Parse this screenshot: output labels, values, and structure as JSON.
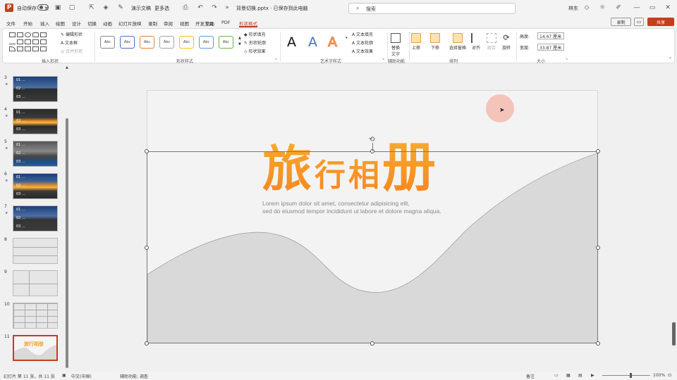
{
  "titlebar": {
    "autosave": "自动保存",
    "autosave_state": "关",
    "present_label": "演示文稿",
    "more_label": "更多选",
    "filename": "背景切换.pptx · 已保存到此电脑",
    "search_placeholder": "搜索",
    "user": "林东",
    "save_icon": "save-icon",
    "brand_color": "#c43e1c"
  },
  "menu": {
    "tabs": [
      "文件",
      "开始",
      "插入",
      "绘图",
      "设计",
      "切换",
      "动画",
      "幻灯片放映",
      "录制",
      "审阅",
      "视图",
      "开发工具",
      "帮助",
      "PDF",
      "形状格式"
    ],
    "active_tab": "形状格式",
    "share_label": "共享",
    "record_label": "录制"
  },
  "ribbon": {
    "groups": {
      "insert_shapes": "插入形状",
      "shape_styles": "形状样式",
      "art_styles": "艺术字样式",
      "accessibility": "辅助功能",
      "arrange": "排列",
      "size": "大小"
    },
    "insert_shapes": {
      "edit_shape": "编辑形状",
      "textbox": "文本框",
      "merge": "合并形状"
    },
    "shape_styles": {
      "fill": "形状填充",
      "outline": "形状轮廓",
      "effects": "形状效果",
      "preset_label": "Abc"
    },
    "art_styles": {
      "letter": "A",
      "fill": "文本填充",
      "outline": "文本轮廓",
      "effects": "文本效果"
    },
    "accessibility": {
      "alt_text_1": "替换",
      "alt_text_2": "文字"
    },
    "arrange": {
      "forward": "上移",
      "backward": "下移",
      "selection_pane": "选择窗格",
      "align": "对齐",
      "group": "组合",
      "rotate": "旋转"
    },
    "size": {
      "height_label": "高度:",
      "height_value": "14.47 厘米",
      "width_label": "宽度:",
      "width_value": "33.87 厘米"
    }
  },
  "thumbnails": [
    {
      "num": "3",
      "star": "★",
      "lines": [
        "01 ...",
        "02 ...",
        "03 ..."
      ],
      "theme": "blue"
    },
    {
      "num": "4",
      "star": "★",
      "lines": [
        "01 ...",
        "02 ...",
        "03 ..."
      ],
      "theme": "sunset"
    },
    {
      "num": "5",
      "star": "★",
      "lines": [
        "01 ...",
        "02 ...",
        "03 ..."
      ],
      "theme": "grey"
    },
    {
      "num": "6",
      "star": "★",
      "lines": [
        "01 ...",
        "02 ...",
        "03 ..."
      ],
      "theme": "sunset"
    },
    {
      "num": "7",
      "star": "★",
      "lines": [
        "01 ...",
        "02 ...",
        "03 ..."
      ],
      "theme": "blue"
    },
    {
      "num": "8",
      "star": "",
      "lines": [],
      "theme": "table1"
    },
    {
      "num": "9",
      "star": "",
      "lines": [],
      "theme": "table2"
    },
    {
      "num": "10",
      "star": "",
      "lines": [],
      "theme": "table3"
    },
    {
      "num": "11",
      "star": "",
      "lines": [],
      "theme": "current",
      "mini_title": "旅行相册"
    }
  ],
  "slide": {
    "title_chars": [
      "旅",
      "行",
      "相",
      "册"
    ],
    "lorem_line1": "Lorem ipsum dolor sit amet, consectetur adipisicing elit,",
    "lorem_line2": "sed do eiusmod tempor incididunt ut labore et dolore magna aliqua.",
    "title_color_top": "#f9b530",
    "title_color_bottom": "#f5831f",
    "wave_fill": "#d9d9d9"
  },
  "status": {
    "slide_info": "幻灯片 第 11 张，共 11 张",
    "language": "中文(中国)",
    "accessibility": "辅助功能: 调查",
    "notes": "备注",
    "zoom": "100%"
  }
}
